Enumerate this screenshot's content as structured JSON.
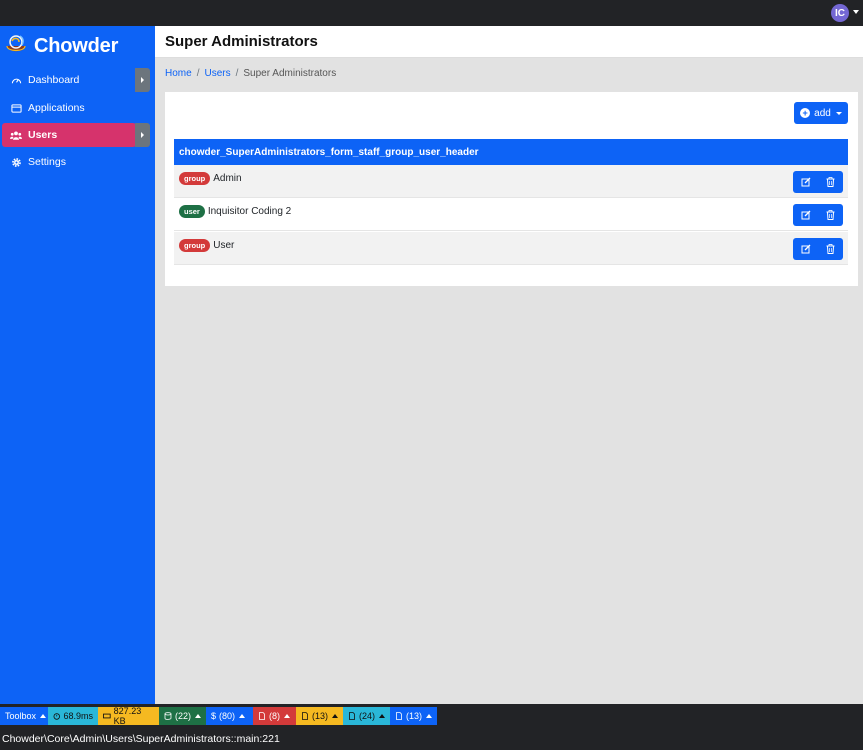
{
  "topbar": {
    "avatar_initials": "IC"
  },
  "brand": {
    "name": "Chowder"
  },
  "sidebar": {
    "items": [
      {
        "label": "Dashboard",
        "icon": "gauge-icon"
      },
      {
        "label": "Applications",
        "icon": "window-icon"
      },
      {
        "label": "Users",
        "icon": "users-icon",
        "active": true
      },
      {
        "label": "Settings",
        "icon": "gear-icon"
      }
    ]
  },
  "page": {
    "title": "Super Administrators"
  },
  "breadcrumb": {
    "home": "Home",
    "users": "Users",
    "current": "Super Administrators"
  },
  "toolbar": {
    "add_label": "add"
  },
  "table": {
    "header": "chowder_SuperAdministrators_form_staff_group_user_header",
    "rows": [
      {
        "badge": "group",
        "name": "Admin"
      },
      {
        "badge": "user",
        "name": "Inquisitor Coding 2"
      },
      {
        "badge": "group",
        "name": "User"
      }
    ]
  },
  "debugbar": {
    "toolbox": "Toolbox",
    "time": "68.9ms",
    "memory": "827.23 KB",
    "database": "(22)",
    "dollar": "(80)",
    "errors": "(8)",
    "warnings": "(13)",
    "info": "(24)",
    "files": "(13)",
    "colors": {
      "toolbox": "#0d63f6",
      "time": "#2ab7d8",
      "memory": "#f5b921",
      "database": "#1e7045",
      "dollar": "#0d63f6",
      "errors": "#d33a3a",
      "warnings": "#f5b921",
      "info": "#2ab7d8",
      "files": "#0d63f6"
    }
  },
  "status": {
    "path": "Chowder\\Core\\Admin\\Users\\SuperAdministrators::main:221"
  },
  "colors": {
    "primary": "#0d63f6",
    "active": "#d6336c",
    "badge_group": "#d33a3a",
    "badge_user": "#1e7045"
  }
}
